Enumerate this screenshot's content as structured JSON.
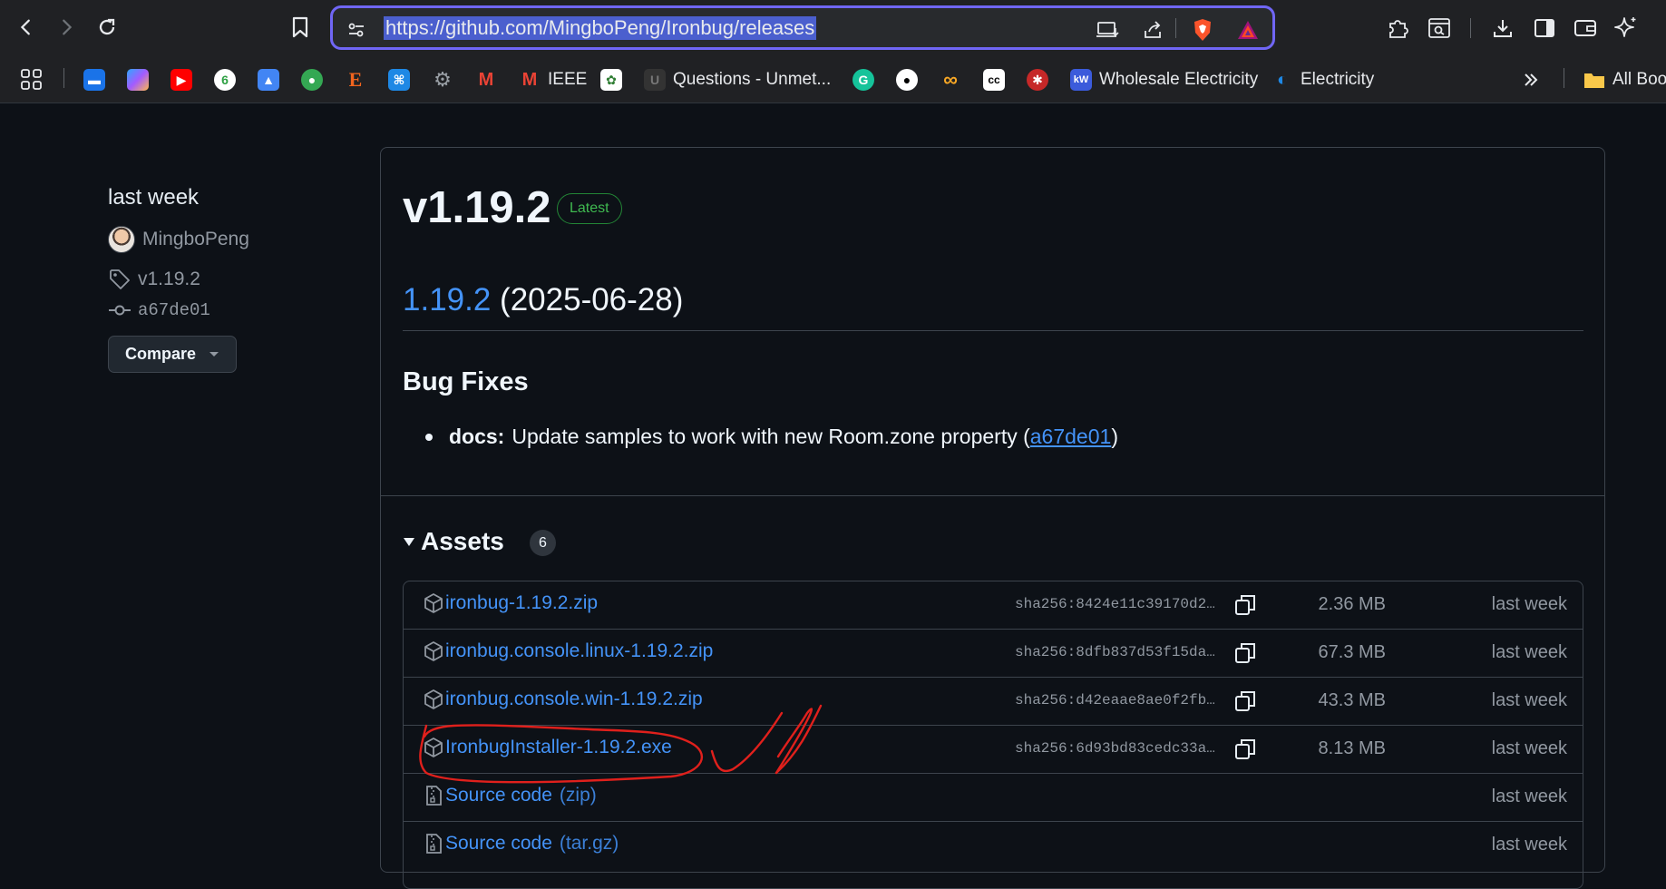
{
  "browser": {
    "url": "https://github.com/MingboPeng/Ironbug/releases",
    "bookmarks": [
      {
        "label": "",
        "icon": "apps-grid-icon"
      },
      {
        "label": "",
        "icon": "book-icon",
        "color": "#1a73e8"
      },
      {
        "label": "",
        "icon": "copilot-icon",
        "color": "#7b61ff"
      },
      {
        "label": "",
        "icon": "youtube-icon",
        "color": "#ff0000"
      },
      {
        "label": "",
        "icon": "leaf-icon",
        "color": "#2ea043"
      },
      {
        "label": "",
        "icon": "graduation-cap-icon",
        "color": "#4285f4"
      },
      {
        "label": "",
        "icon": "people-icon",
        "color": "#34a853"
      },
      {
        "label": "",
        "icon": "etsy-icon",
        "color": "#f1641e"
      },
      {
        "label": "",
        "icon": "puzzle-icon",
        "color": "#1e88e5"
      },
      {
        "label": "",
        "icon": "gear-icon",
        "color": "#9aa0a6"
      },
      {
        "label": "",
        "icon": "gmail-icon",
        "color": "#ea4335"
      },
      {
        "label": "IEEE",
        "icon": "gmail-icon",
        "color": "#ea4335"
      },
      {
        "label": "",
        "icon": "plant-icon",
        "color": "#2e7d32"
      },
      {
        "label": "Questions - Unmet...",
        "icon": "u-icon",
        "color": "#444444"
      },
      {
        "label": "",
        "icon": "grammarly-icon",
        "color": "#15c39a"
      },
      {
        "label": "",
        "icon": "github-icon",
        "color": "#ffffff"
      },
      {
        "label": "",
        "icon": "infinity-icon",
        "color": "#f9a825"
      },
      {
        "label": "",
        "icon": "cc-icon",
        "color": "#ffffff"
      },
      {
        "label": "",
        "icon": "spider-icon",
        "color": "#c62828"
      },
      {
        "label": "Wholesale Electricity",
        "icon": "kw-icon",
        "color": "#3b5bdb"
      },
      {
        "label": "Electricity",
        "icon": "globe-icon",
        "color": "#1e88e5"
      }
    ],
    "all_bookmarks": "All Boo"
  },
  "sidebar": {
    "date": "last week",
    "author": "MingboPeng",
    "tag": "v1.19.2",
    "commit": "a67de01",
    "compare_label": "Compare"
  },
  "release": {
    "title": "v1.19.2",
    "badge": "Latest",
    "version_link": "1.19.2",
    "version_date": "(2025-06-28)",
    "bugfix_heading": "Bug Fixes",
    "bullet": {
      "scope": "docs:",
      "text": "Update samples to work with new Room.zone property (",
      "commit": "a67de01",
      "close": ")"
    },
    "assets_label": "Assets",
    "assets_count": "6",
    "assets": [
      {
        "name": "ironbug-1.19.2.zip",
        "suffix": "",
        "sha": "sha256:8424e11c39170d2…",
        "size": "2.36 MB",
        "date": "last week"
      },
      {
        "name": "ironbug.console.linux-1.19.2.zip",
        "suffix": "",
        "sha": "sha256:8dfb837d53f15da…",
        "size": "67.3 MB",
        "date": "last week"
      },
      {
        "name": "ironbug.console.win-1.19.2.zip",
        "suffix": "",
        "sha": "sha256:d42eaae8ae0f2fb…",
        "size": "43.3 MB",
        "date": "last week"
      },
      {
        "name": "IronbugInstaller-1.19.2.exe",
        "suffix": "",
        "sha": "sha256:6d93bd83cedc33a…",
        "size": "8.13 MB",
        "date": "last week"
      },
      {
        "name": "Source code",
        "suffix": "(zip)",
        "sha": "",
        "size": "",
        "date": "last week"
      },
      {
        "name": "Source code",
        "suffix": "(tar.gz)",
        "sha": "",
        "size": "",
        "date": "last week"
      }
    ]
  },
  "colors": {
    "background": "#0d1117",
    "link": "#4493f8",
    "annotation": "#e0201c",
    "omnibox_border": "#7066f5"
  }
}
